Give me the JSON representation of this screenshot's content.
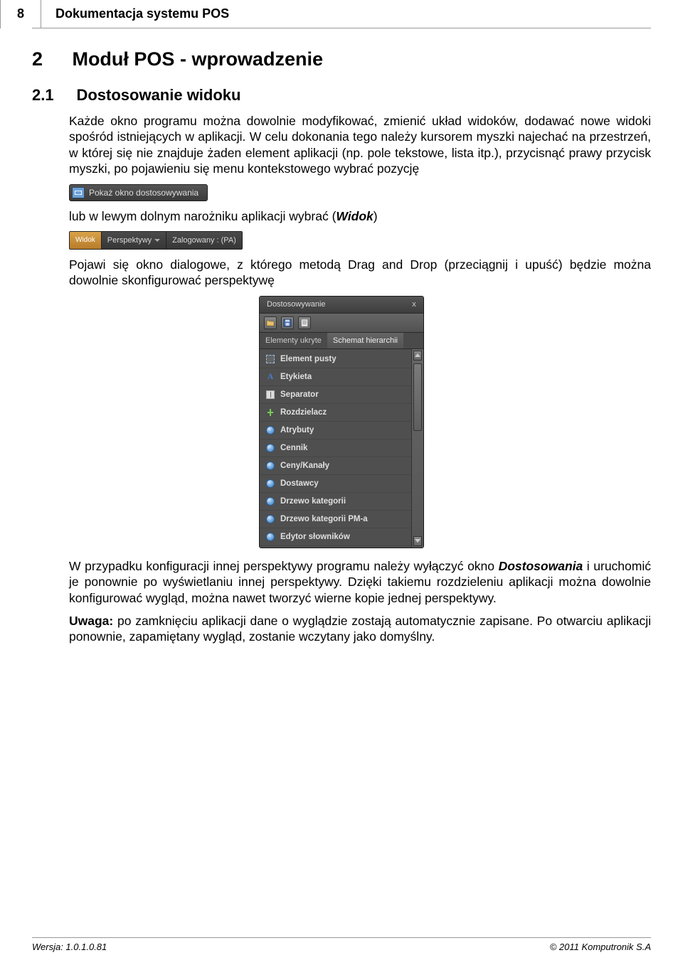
{
  "header": {
    "page_number": "8",
    "doc_title": "Dokumentacja systemu POS"
  },
  "h1": {
    "num": "2",
    "text": "Moduł POS -  wprowadzenie"
  },
  "h2": {
    "num": "2.1",
    "text": "Dostosowanie widoku"
  },
  "para1": "Każde okno programu można dowolnie modyfikować, zmienić układ widoków, dodawać nowe widoki spośród istniejących w aplikacji. W celu dokonania tego należy kursorem myszki najechać na przestrzeń, w której się nie znajduje żaden element aplikacji (np. pole tekstowe, lista itp.), przycisnąć prawy przycisk myszki, po pojawieniu się menu kontekstowego wybrać pozycję",
  "context_menu": {
    "label": "Pokaż okno dostosowywania"
  },
  "para2_pre": "lub w lewym dolnym narożniku aplikacji wybrać  (",
  "para2_italic": "Widok",
  "para2_post": ")",
  "status_bar": {
    "widok": "Widok",
    "perspektywy": "Perspektywy",
    "zalogowany": "Zalogowany : (PA)"
  },
  "para3": "Pojawi się okno dialogowe, z którego metodą Drag and Drop (przeciągnij i upuść) będzie można dowolnie skonfigurować perspektywę",
  "dialog": {
    "title": "Dostosowywanie",
    "tabs": {
      "t1": "Elementy ukryte",
      "t2": "Schemat hierarchii"
    },
    "items": [
      {
        "icon": "square-dashed",
        "label": "Element pusty"
      },
      {
        "icon": "letter-a",
        "label": "Etykieta"
      },
      {
        "icon": "separator",
        "label": "Separator"
      },
      {
        "icon": "splitter",
        "label": "Rozdzielacz"
      },
      {
        "icon": "dot",
        "label": "Atrybuty"
      },
      {
        "icon": "dot",
        "label": "Cennik"
      },
      {
        "icon": "dot",
        "label": "Ceny/Kanały"
      },
      {
        "icon": "dot",
        "label": "Dostawcy"
      },
      {
        "icon": "dot",
        "label": "Drzewo kategorii"
      },
      {
        "icon": "dot",
        "label": "Drzewo kategorii PM-a"
      },
      {
        "icon": "dot",
        "label": "Edytor słowników"
      }
    ]
  },
  "para4_a": "W przypadku konfiguracji innej perspektywy programu należy wyłączyć okno ",
  "para4_italic": "Dostosowania",
  "para4_b": " i uruchomić je ponownie  po wyświetlaniu innej perspektywy.  Dzięki takiemu rozdzieleniu aplikacji można dowolnie konfigurować wygląd, można nawet tworzyć wierne kopie jednej perspektywy.",
  "para5_bold": "Uwaga:",
  "para5_rest": " po zamknięciu aplikacji dane o wyglądzie zostają automatycznie zapisane. Po otwarciu aplikacji ponownie, zapamiętany wygląd, zostanie wczytany jako domyślny.",
  "footer": {
    "version": "Wersja: 1.0.1.0.81",
    "copyright": "© 2011 Komputronik S.A"
  }
}
